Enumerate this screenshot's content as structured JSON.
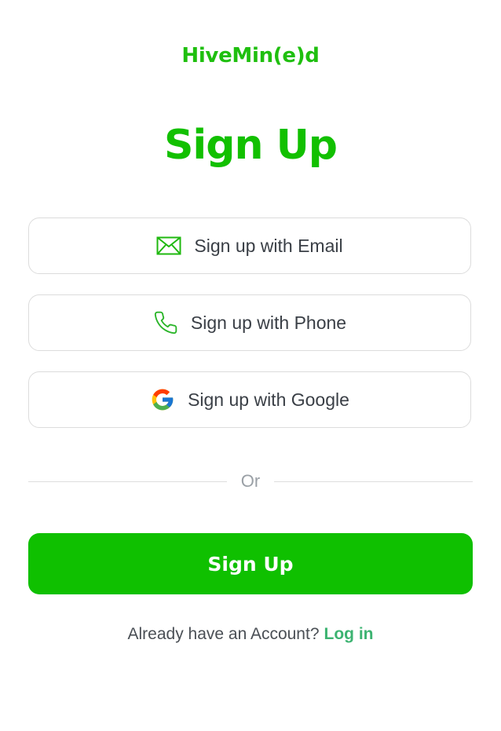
{
  "brand": "HiveMin(e)d",
  "title": "Sign Up",
  "options": {
    "email": {
      "label": "Sign up with Email",
      "icon": "envelope-icon"
    },
    "phone": {
      "label": "Sign up with Phone",
      "icon": "phone-icon"
    },
    "google": {
      "label": "Sign up with Google",
      "icon": "google-icon"
    }
  },
  "divider": "Or",
  "primary_label": "Sign Up",
  "footer": {
    "prompt": "Already have an Account?",
    "link": "Log in"
  },
  "colors": {
    "brand": "#1fbf0f",
    "primary": "#0fc000",
    "link": "#3cb371"
  }
}
